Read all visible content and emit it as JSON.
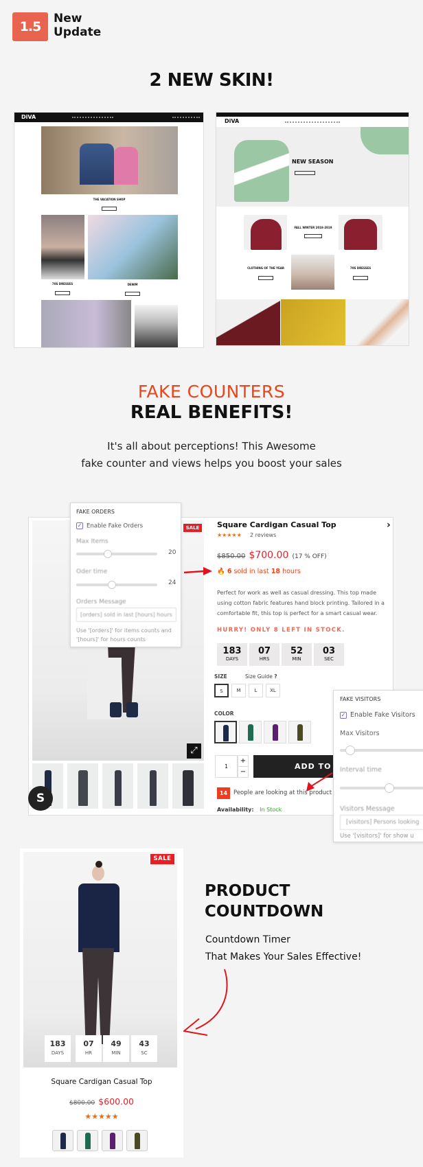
{
  "header": {
    "version": "1.5",
    "title_line1": "New",
    "title_line2": "Update"
  },
  "skins": {
    "heading": "2 NEW SKIN!",
    "left": {
      "logo": "DiVA",
      "captions": [
        "THE VACATION SHOP",
        "70S DRESSES",
        "DENIM"
      ]
    },
    "right": {
      "logo": "DiVA",
      "hero_title": "NEW SEASON",
      "captions": [
        "FALL WINTER 2018-2019",
        "CLOTHING OF THE YEAR",
        "70S DRESSES"
      ]
    }
  },
  "counters": {
    "heading_accent": "FAKE COUNTERS",
    "heading": "REAL BENEFITS!",
    "desc_line1": "It's all about perceptions! This Awesome",
    "desc_line2": "fake counter and views helps you boost your sales",
    "accent_color": "#e8461c"
  },
  "fake_orders": {
    "title": "FAKE ORDERS",
    "enable_label": "Enable Fake Orders",
    "enabled": true,
    "max_items_label": "Max Items",
    "max_items": "20",
    "order_time_label": "Oder time",
    "order_time": "24",
    "message_label": "Orders Message",
    "message_value": "[orders] sold in last [hours] hours",
    "help_line1": "Use '[orders]' for items counts and",
    "help_line2": "'[hours]' for hours counts"
  },
  "product": {
    "sale_badge": "SALE",
    "title": "Square Cardigan Casual Top",
    "rating": 5,
    "reviews": "2 reviews",
    "old_price": "$850.00",
    "price": "$700.00",
    "discount": "(17 % OFF)",
    "sold_count": "6",
    "sold_mid": " sold in last ",
    "sold_hours": "18",
    "sold_end": " hours",
    "description": "Perfect for work as well as casual dressing. This top made using cotton fabric features hand block printing. Tailored in a comfortable fit, this top is perfect for a smart casual wear.",
    "hurry": "HURRY! ONLY 8 LEFT IN STOCK.",
    "countdown": [
      {
        "value": "183",
        "unit": "DAYS"
      },
      {
        "value": "07",
        "unit": "HRS"
      },
      {
        "value": "52",
        "unit": "MIN"
      },
      {
        "value": "03",
        "unit": "SEC"
      }
    ],
    "size_label": "SIZE",
    "size_guide": "Size Guide",
    "sizes": [
      "S",
      "M",
      "L",
      "XL"
    ],
    "selected_size": "S",
    "color_label": "COLOR",
    "colors": [
      "#1e2a4a",
      "#1f6b52",
      "#5a1f6e",
      "#4a4a24"
    ],
    "quantity": "1",
    "add_to_cart": "ADD TO CART",
    "viewers": "14",
    "viewers_text": "People are looking at this product",
    "availability_label": "Availability:",
    "availability": "In Stock"
  },
  "fake_visitors": {
    "title": "FAKE VISITORS",
    "enable_label": "Enable Fake Visitors",
    "enabled": true,
    "max_label": "Max Visitors",
    "interval_label": "Interval time",
    "message_label": "Visitors Message",
    "message_value": "[visitors] Persons looking",
    "help": "Use '[visitors]' for show u"
  },
  "countdown_section": {
    "heading_line1": "PRODUCT",
    "heading_line2": "COUNTDOWN",
    "sub_line1": "Countdown Timer",
    "sub_line2": "That Makes Your Sales Effective!",
    "card": {
      "sale_badge": "SALE",
      "countdown": [
        {
          "value": "183",
          "unit": "DAYS"
        },
        {
          "value": "07",
          "unit": "HR"
        },
        {
          "value": "49",
          "unit": "MIN"
        },
        {
          "value": "43",
          "unit": "SC"
        }
      ],
      "title": "Square Cardigan Casual Top",
      "old_price": "$800.00",
      "price": "$600.00",
      "rating": 5,
      "colors": [
        "#1e2a4a",
        "#1f6b52",
        "#5a1f6e",
        "#4a4a24"
      ]
    }
  }
}
